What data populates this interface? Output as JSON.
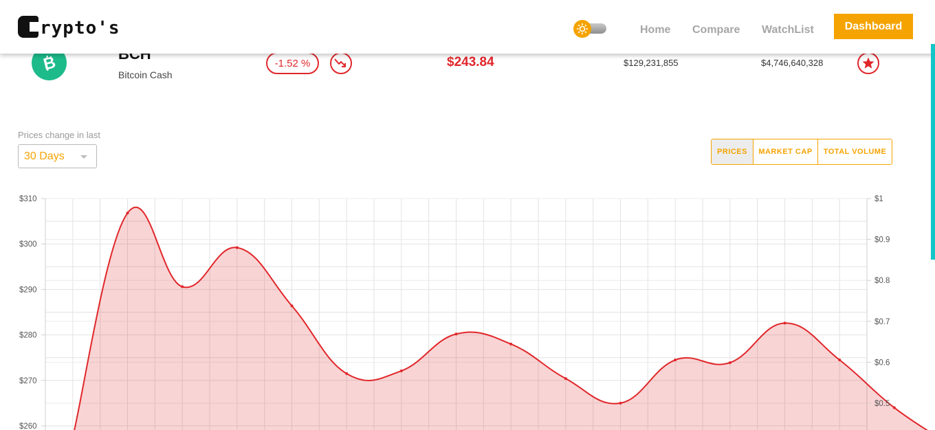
{
  "header": {
    "logo_text": "rypto's",
    "nav": [
      {
        "label": "Home"
      },
      {
        "label": "Compare"
      },
      {
        "label": "WatchList"
      }
    ],
    "dashboard_button": "Dashboard",
    "theme_toggle_icon": "sun-icon"
  },
  "coin": {
    "symbol": "BCH",
    "name": "Bitcoin Cash",
    "change": "-1.52 %",
    "trend_icon": "trending-down-icon",
    "price": "$243.84",
    "volume": "$129,231,855",
    "market_cap": "$4,746,640,328",
    "watchlist_icon": "star-icon",
    "accent_color": "#e0262a",
    "icon_color": "#1dbb8a"
  },
  "controls": {
    "period_label": "Prices change in last",
    "period_value": "30 Days",
    "toggles": [
      {
        "label": "PRICES",
        "active": true
      },
      {
        "label": "MARKET CAP",
        "active": false
      },
      {
        "label": "TOTAL VOLUME",
        "active": false
      }
    ],
    "brand_color": "#f5a300"
  },
  "chart_data": {
    "type": "area",
    "title": "",
    "grid": true,
    "y_left": {
      "ticks": [
        "$310",
        "$300",
        "$290",
        "$280",
        "$270",
        "$260"
      ],
      "ylim": [
        260,
        310
      ]
    },
    "y_right": {
      "ticks": [
        "$1",
        "$0.9",
        "$0.8",
        "$0.7",
        "$0.6",
        "$0.5"
      ],
      "ylim": [
        0.5,
        1
      ]
    },
    "series": [
      {
        "color": "#e0262a",
        "fill": "rgba(224,38,42,0.2)",
        "values": [
          257.5,
          306.8,
          290.6,
          299.2,
          286.4,
          271.5,
          272.1,
          280.2,
          278.0,
          270.4,
          265.0,
          274.5,
          273.9,
          282.6,
          274.5,
          264.0,
          256.0
        ]
      }
    ]
  }
}
